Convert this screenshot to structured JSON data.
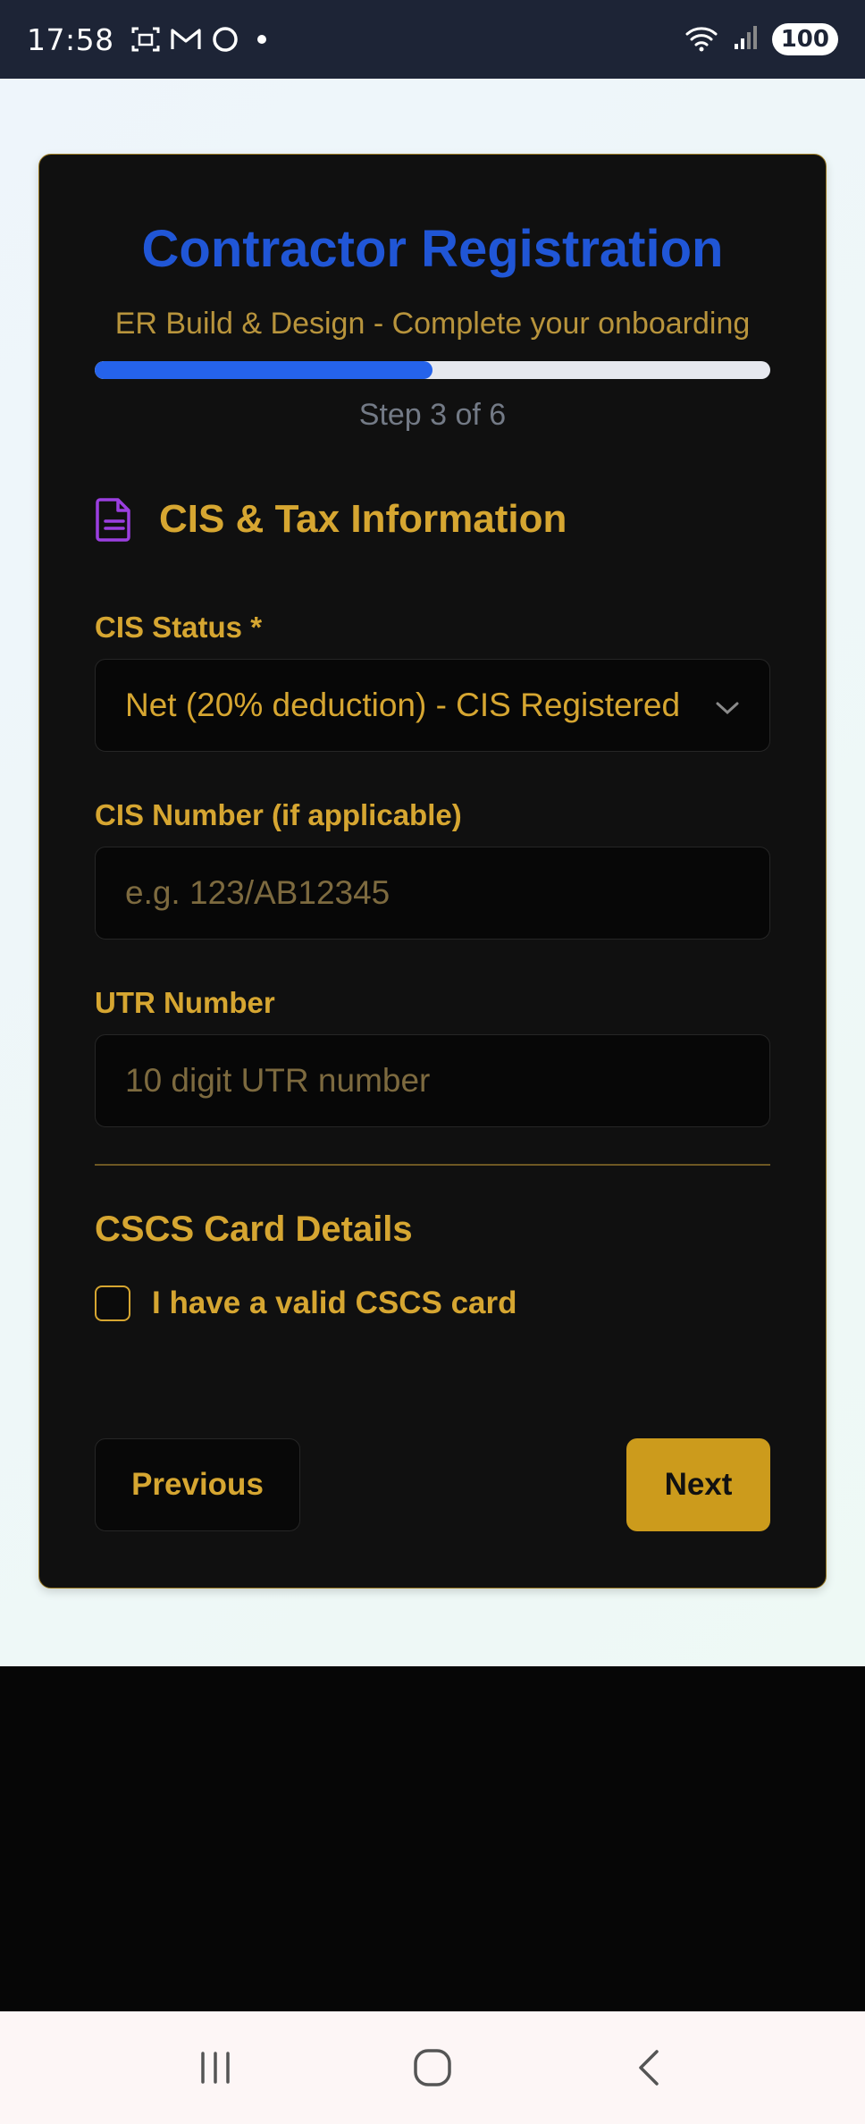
{
  "status_bar": {
    "time": "17:58",
    "battery": "100",
    "left_icons": [
      "screenshot-icon",
      "gmail-icon",
      "circle-app-icon",
      "notification-dot"
    ],
    "right_icons": [
      "wifi-icon",
      "signal-icon",
      "battery-icon"
    ]
  },
  "form": {
    "title": "Contractor Registration",
    "subtitle": "ER Build & Design - Complete your onboarding",
    "progress_fraction": 0.5,
    "step_text": "Step 3 of 6",
    "section": {
      "icon": "document-icon",
      "title": "CIS & Tax Information"
    },
    "cis_status": {
      "label": "CIS Status *",
      "selected": "Net (20% deduction) - CIS Registered"
    },
    "cis_number": {
      "label": "CIS Number (if applicable)",
      "placeholder": "e.g. 123/AB12345"
    },
    "utr_number": {
      "label": "UTR Number",
      "placeholder": "10 digit UTR number"
    },
    "cscs": {
      "title": "CSCS Card Details",
      "checkbox_label": "I have a valid CSCS card",
      "checked": false
    },
    "buttons": {
      "previous": "Previous",
      "next": "Next"
    }
  },
  "colors": {
    "accent_gold": "#d6a631",
    "title_blue": "#2056d6",
    "progress_blue": "#2563eb",
    "card_bg": "#101010"
  },
  "navbar": {
    "icons": [
      "recent-apps-icon",
      "home-icon",
      "back-icon"
    ]
  }
}
